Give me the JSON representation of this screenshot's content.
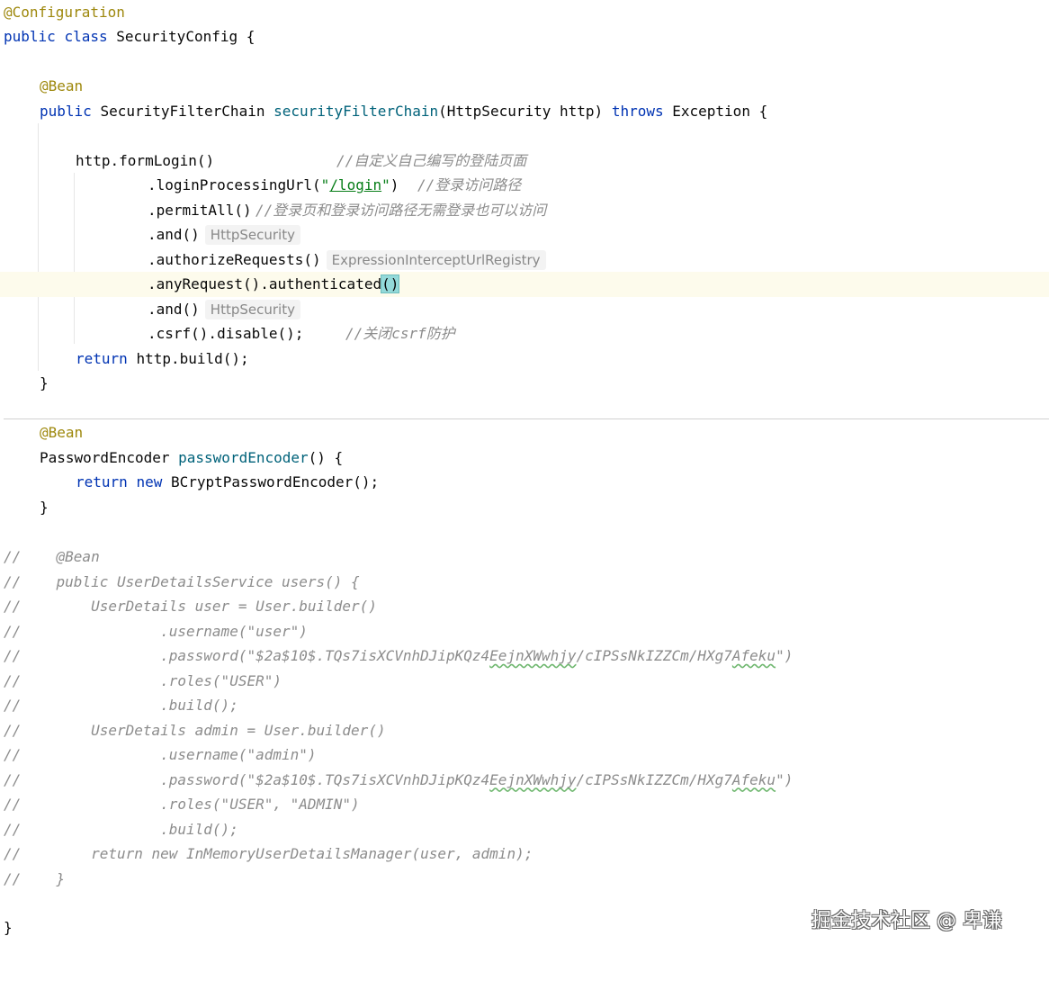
{
  "editor": {
    "language": "Java",
    "caret_line": "anyRequest"
  },
  "code": {
    "l1_annotation": "@Configuration",
    "l2_public": "public",
    "l2_class": "class",
    "l2_rest": "SecurityConfig {",
    "l4_annotation": "@Bean",
    "l5_public": "public",
    "l5_type": "SecurityFilterChain",
    "l5_method": "securityFilterChain",
    "l5_params": "(HttpSecurity http)",
    "l5_throws": "throws",
    "l5_rest": "Exception {",
    "l7_code": "http.formLogin()",
    "l7_comment": "//自定义自己编写的登陆页面",
    "l8_code_a": ".loginProcessingUrl(",
    "l8_quote_open": "\"",
    "l8_string": "/login",
    "l8_quote_close": "\"",
    "l8_code_b": ")",
    "l8_comment": "//登录访问路径",
    "l9_code": ".permitAll()",
    "l9_comment": "//登录页和登录访问路径无需登录也可以访问",
    "l10_code": ".and()",
    "l10_hint": "HttpSecurity",
    "l11_code": ".authorizeRequests()",
    "l11_hint": "ExpressionInterceptUrlRegistry",
    "l12_code": ".anyRequest().authenticated",
    "l12_parens": "()",
    "l13_code": ".and()",
    "l13_hint": "HttpSecurity",
    "l14_code": ".csrf().disable();",
    "l14_comment": "//关闭csrf防护",
    "l15_return": "return",
    "l15_rest": "http.build();",
    "l16_close": "}",
    "l18_annotation": "@Bean",
    "l19_type": "PasswordEncoder",
    "l19_method": "passwordEncoder",
    "l19_rest": "() {",
    "l20_return": "return",
    "l20_new": "new",
    "l20_rest": "BCryptPasswordEncoder();",
    "l21_close": "}",
    "commented": [
      {
        "mark": "//",
        "text": "    @Bean"
      },
      {
        "mark": "//",
        "text": "    public UserDetailsService users() {"
      },
      {
        "mark": "//",
        "text": "        UserDetails user = User.builder()"
      },
      {
        "mark": "//",
        "text": "                .username(\"user\")"
      },
      {
        "mark": "//",
        "pre": "                .password(\"$2a$10$.TQs7isXCVnhDJipKQz4",
        "w1": "EejnXWwhjy",
        "mid": "/cIPSsNkIZZCm/HXg7",
        "w2": "Afeku",
        "post": "\")"
      },
      {
        "mark": "//",
        "text": "                .roles(\"USER\")"
      },
      {
        "mark": "//",
        "text": "                .build();"
      },
      {
        "mark": "//",
        "text": "        UserDetails admin = User.builder()"
      },
      {
        "mark": "//",
        "text": "                .username(\"admin\")"
      },
      {
        "mark": "//",
        "pre": "                .password(\"$2a$10$.TQs7isXCVnhDJipKQz4",
        "w1": "EejnXWwhjy",
        "mid": "/cIPSsNkIZZCm/HXg7",
        "w2": "Afeku",
        "post": "\")"
      },
      {
        "mark": "//",
        "text": "                .roles(\"USER\", \"ADMIN\")"
      },
      {
        "mark": "//",
        "text": "                .build();"
      },
      {
        "mark": "//",
        "text": "        return new InMemoryUserDetailsManager(user, admin);"
      },
      {
        "mark": "//",
        "text": "    }"
      }
    ],
    "final_close": "}"
  },
  "watermark": "掘金技术社区 @ 卑谦",
  "colors": {
    "annotation": "#9e880d",
    "keyword": "#0033b3",
    "method": "#00627a",
    "string": "#067d17",
    "comment": "#8c8c8c",
    "current_line": "#fdfbec",
    "brace_match": "#93d9d9"
  }
}
